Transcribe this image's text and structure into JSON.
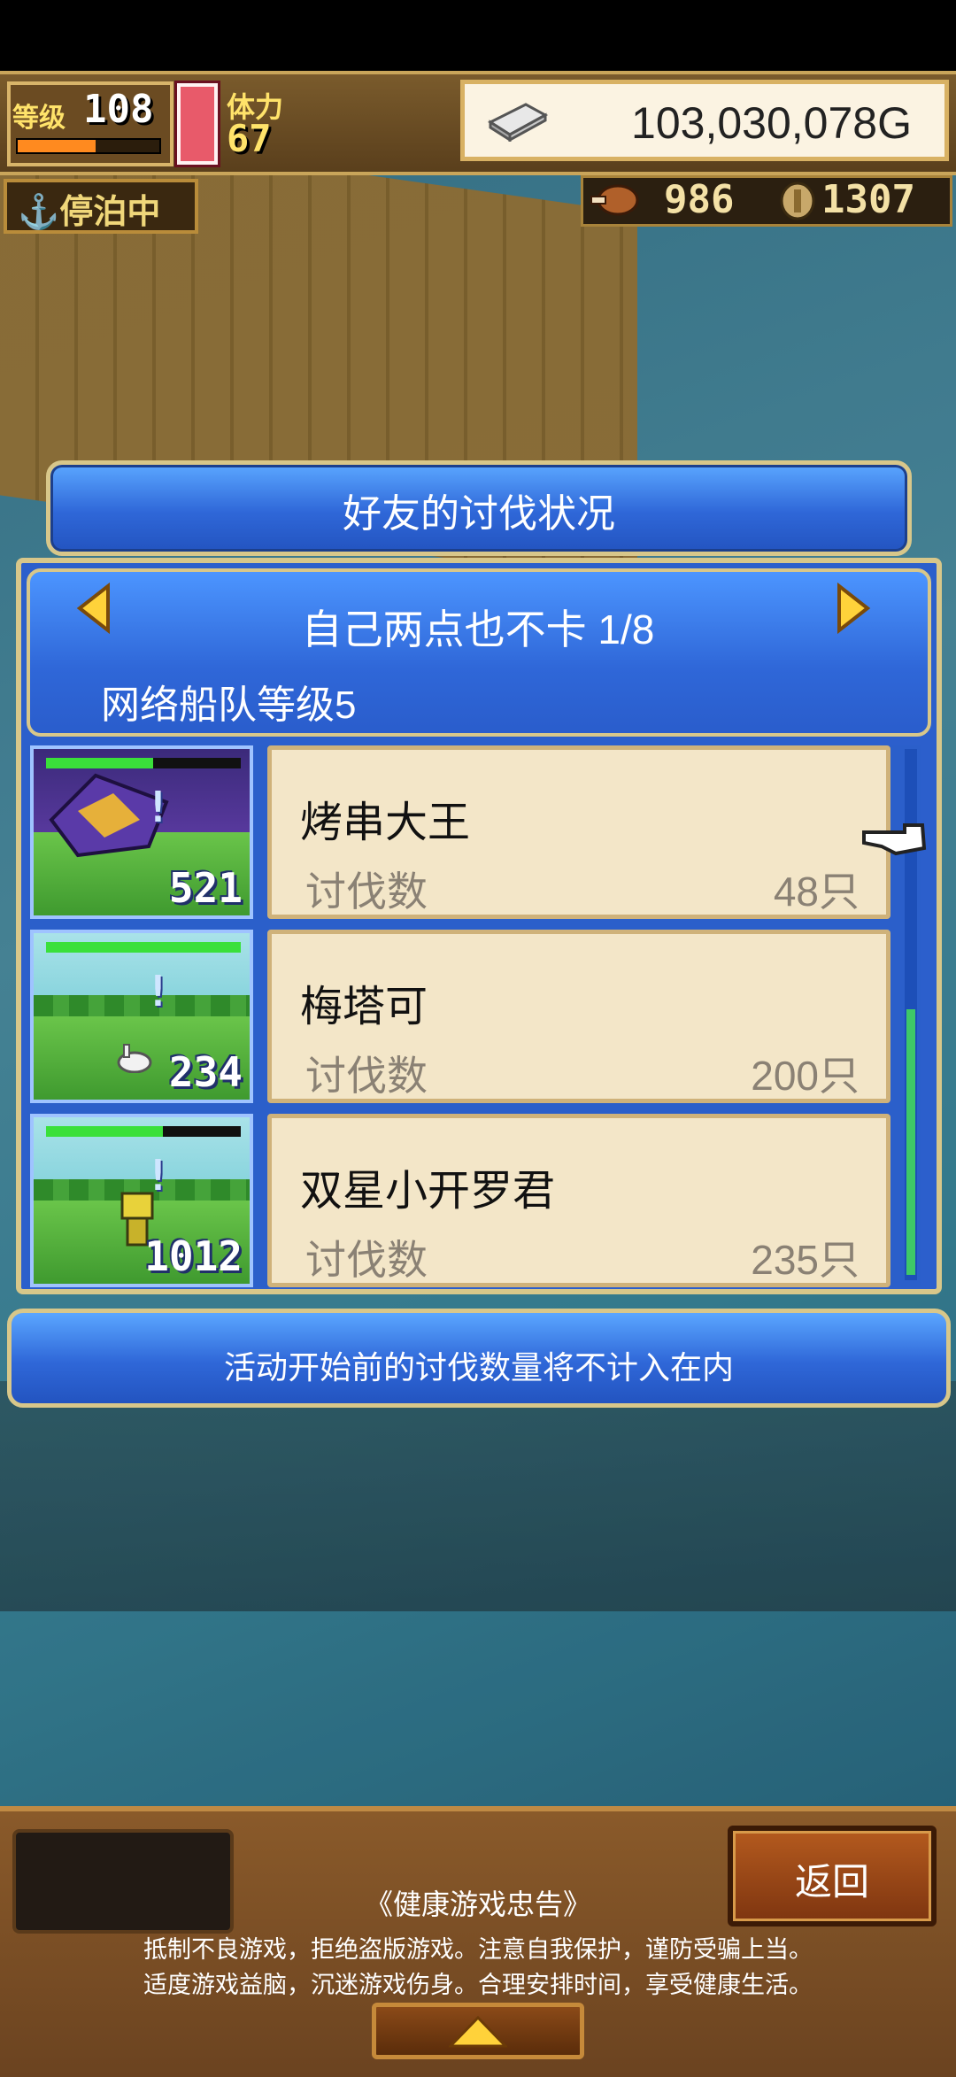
{
  "topbar": {
    "level_label": "等级",
    "level_value": "108",
    "level_progress": 0.55,
    "stamina_label": "体力",
    "stamina_value": "67",
    "gold": "103,030,078G",
    "dock_status": "停泊中",
    "food": "986",
    "wood": "1307"
  },
  "dialog": {
    "title": "好友的讨伐状况",
    "friend_header": "自己两点也不卡 1/8",
    "fleet_level": "网络船队等级5",
    "rows": [
      {
        "name": "烤串大王",
        "label": "讨伐数",
        "value": "48只",
        "thumb_number": "521",
        "hp": 0.55
      },
      {
        "name": "梅塔可",
        "label": "讨伐数",
        "value": "200只",
        "thumb_number": "234",
        "hp": 1.0
      },
      {
        "name": "双星小开罗君",
        "label": "讨伐数",
        "value": "235只",
        "thumb_number": "1012",
        "hp": 0.6
      }
    ],
    "notice": "活动开始前的讨伐数量将不计入在内"
  },
  "bottom": {
    "back_label": "返回",
    "health_title": "《健康游戏忠告》",
    "health_line1": "抵制不良游戏，拒绝盗版游戏。注意自我保护，谨防受骗上当。",
    "health_line2": "适度游戏益脑，沉迷游戏伤身。合理安排时间，享受健康生活。"
  },
  "colors": {
    "panel_blue": "#2c5fcc",
    "card_cream": "#f3e6c8",
    "gold_border": "#d8c78a",
    "hp_green": "#3ae03a"
  },
  "icons": [
    "silver-bar-icon",
    "meat-icon",
    "wood-coin-icon",
    "anchor-icon",
    "arrow-left-icon",
    "arrow-right-icon",
    "pointing-hand-icon",
    "up-triangle-icon"
  ]
}
